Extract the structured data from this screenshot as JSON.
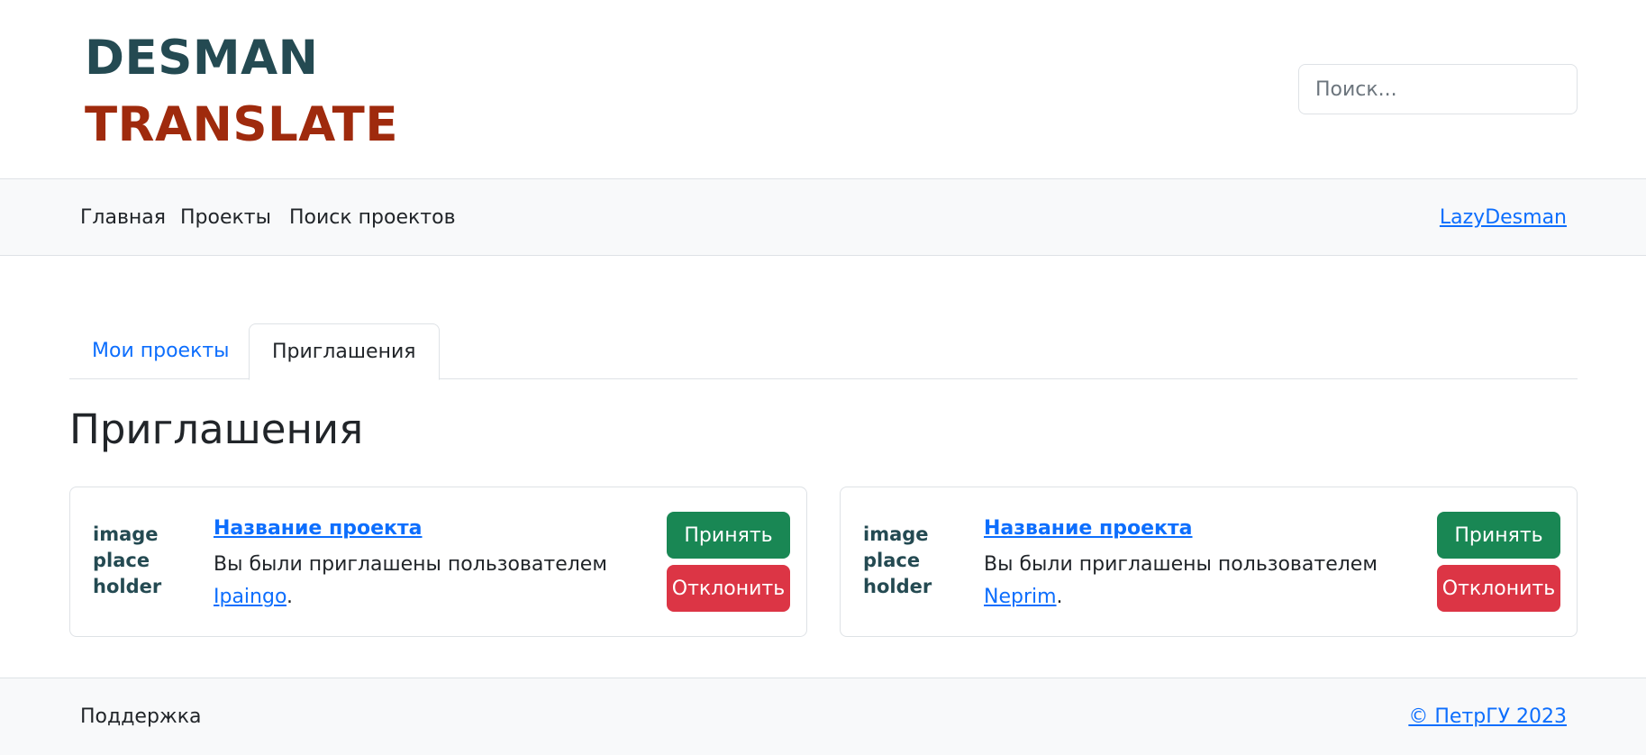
{
  "header": {
    "logo_line1": "DESMAN",
    "logo_line2": "TRANSLATE",
    "search_placeholder": "Поиск..."
  },
  "nav": {
    "items": [
      {
        "label": "Главная"
      },
      {
        "label": "Проекты"
      },
      {
        "label": "Поиск проектов"
      }
    ],
    "user": "LazyDesman"
  },
  "tabs": [
    {
      "label": "Мои проекты",
      "active": false
    },
    {
      "label": "Приглашения",
      "active": true
    }
  ],
  "page_title": "Приглашения",
  "invitations": [
    {
      "image_placeholder": [
        "image",
        "place",
        "holder"
      ],
      "project_name": "Название проекта",
      "text": "Вы были приглашены пользователем",
      "inviter": "Ipaingo",
      "suffix": ".",
      "accept_label": "Принять",
      "reject_label": "Отклонить"
    },
    {
      "image_placeholder": [
        "image",
        "place",
        "holder"
      ],
      "project_name": "Название проекта",
      "text": "Вы были приглашены пользователем",
      "inviter": "Neprim",
      "suffix": ".",
      "accept_label": "Принять",
      "reject_label": "Отклонить"
    }
  ],
  "footer": {
    "support": "Поддержка",
    "copyright": "© ПетрГУ 2023"
  },
  "colors": {
    "logo_dark": "#244a52",
    "logo_red": "#9f2a0d",
    "link": "#0d6efd",
    "accept": "#198754",
    "reject": "#dc3545"
  }
}
